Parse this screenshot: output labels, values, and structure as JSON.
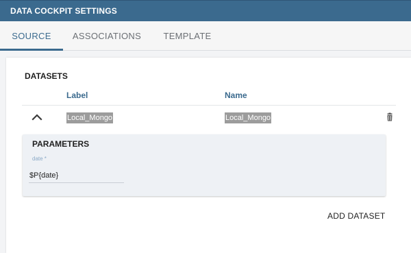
{
  "title": "DATA COCKPIT SETTINGS",
  "tabs": [
    {
      "label": "SOURCE",
      "active": true
    },
    {
      "label": "ASSOCIATIONS",
      "active": false
    },
    {
      "label": "TEMPLATE",
      "active": false
    }
  ],
  "datasets": {
    "title": "DATASETS",
    "columns": {
      "label": "Label",
      "name": "Name"
    },
    "rows": [
      {
        "label": "Local_Mongo",
        "name": "Local_Mongo"
      }
    ]
  },
  "parameters": {
    "title": "PARAMETERS",
    "field": {
      "label": "date *",
      "value": "$P{date}"
    }
  },
  "add_dataset_label": "ADD DATASET",
  "icons": {
    "row_toggle": "chevron-up-icon",
    "delete": "trash-icon"
  },
  "colors": {
    "accent": "#3b6a8e",
    "highlight": "#9c9c9c"
  }
}
